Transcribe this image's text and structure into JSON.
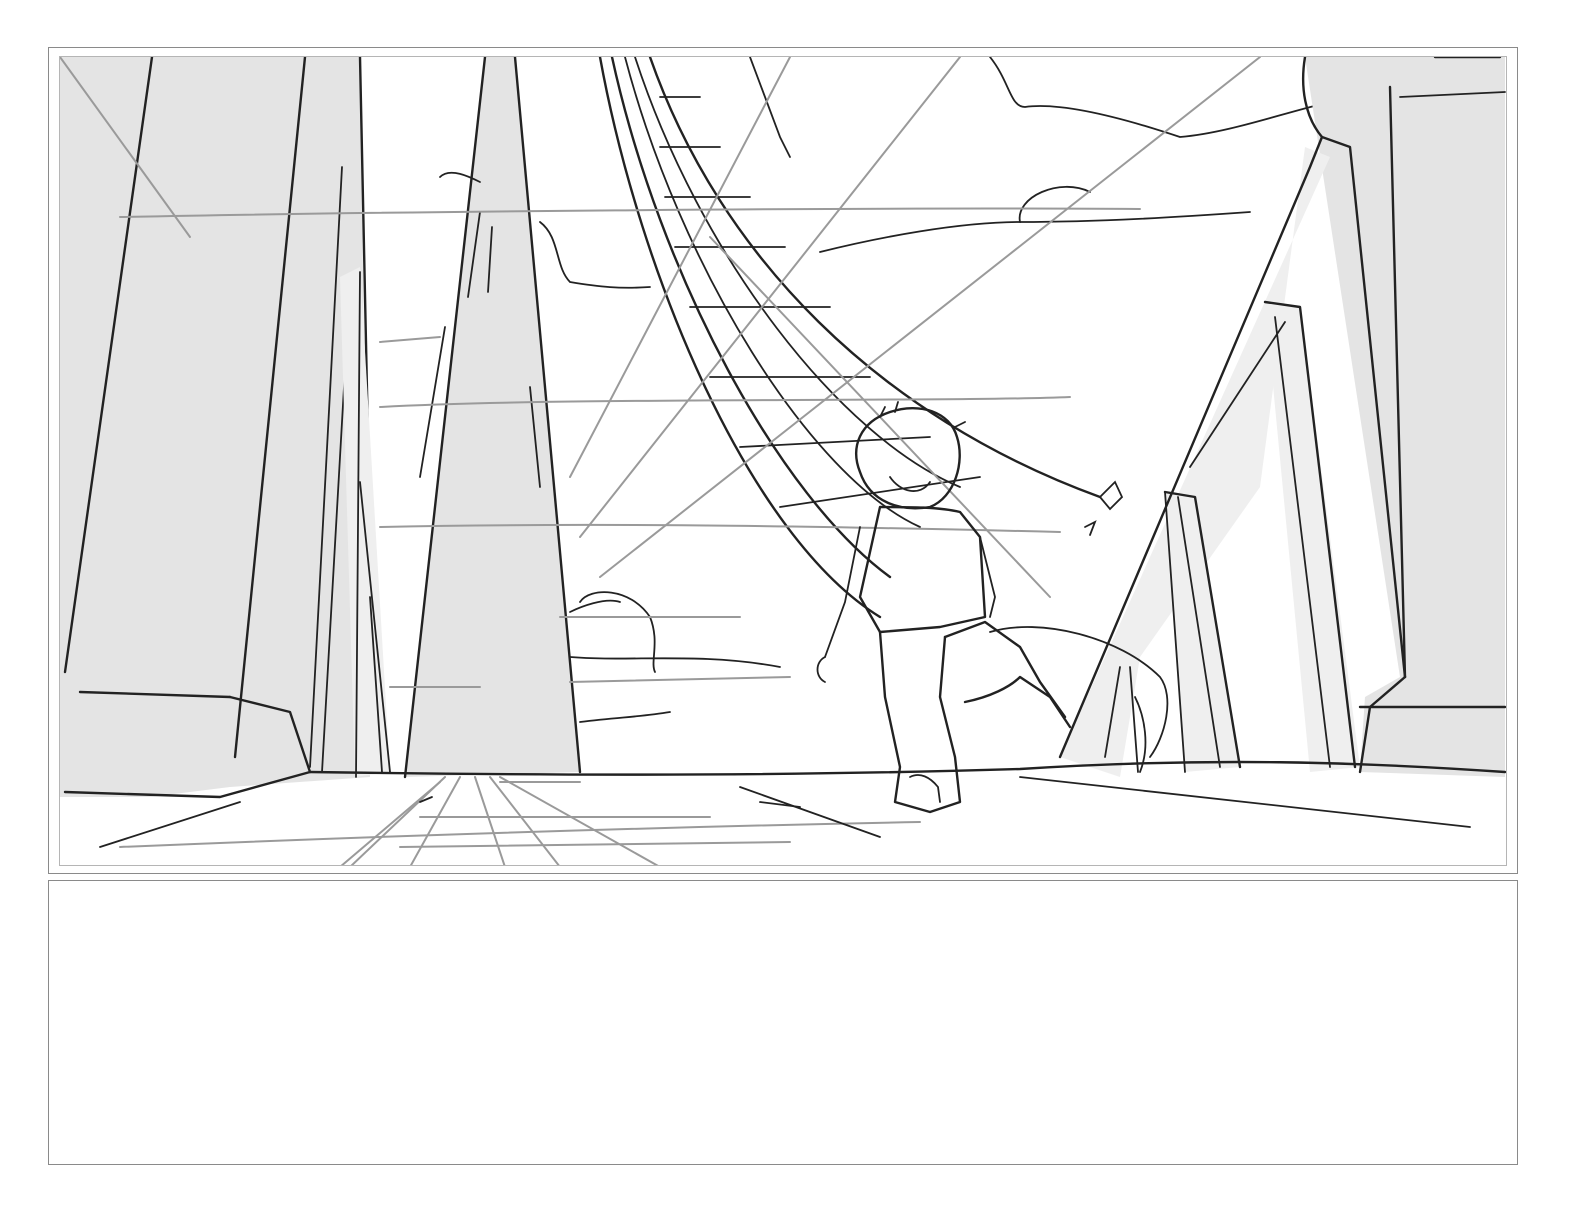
{
  "storyboard": {
    "panel_1": {
      "scene": "sketch",
      "colors": {
        "ink": "#222222",
        "construction": "#9a9a9a",
        "tone": "#e4e4e4"
      }
    },
    "notes_box": {
      "text": ""
    }
  }
}
